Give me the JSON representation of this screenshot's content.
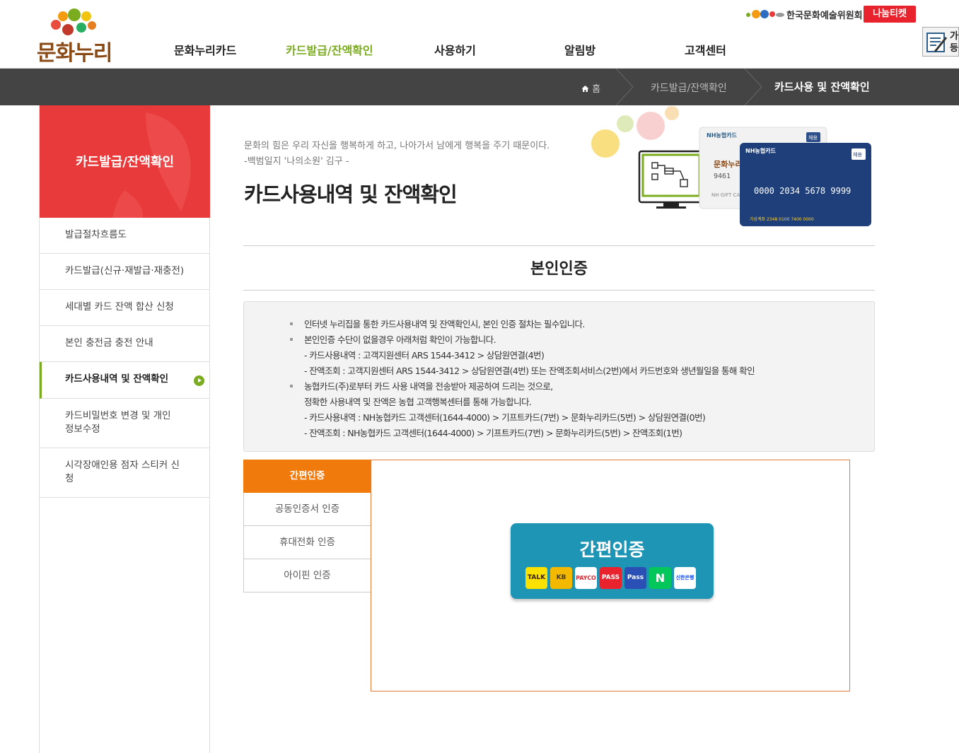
{
  "header": {
    "logo_text": "문화누리",
    "nav": [
      "문화누리카드",
      "카드발급/잔액확인",
      "사용하기",
      "알림방",
      "고객센터"
    ],
    "active_nav": 1,
    "partner_text": "한국문화예술위원회",
    "nanum_label": "나눔티켓",
    "side_tab_text": [
      "가",
      "등"
    ]
  },
  "breadcrumb": {
    "home": "홈",
    "section": "카드발급/잔액확인",
    "current": "카드사용 및 잔액확인"
  },
  "sidebar": {
    "title": "카드발급/잔액확인",
    "items": [
      {
        "label": "발급절차흐름도"
      },
      {
        "label": "카드발급(신규·재발급·재충전)"
      },
      {
        "label": "세대별 카드 잔액 합산 신청"
      },
      {
        "label": "본인 충전금 충전 안내"
      },
      {
        "label": "카드사용내역 및 잔액확인"
      },
      {
        "label": "카드비밀번호 변경 및 개인 정보수정"
      },
      {
        "label": "시각장애인용 점자 스티커 신청"
      }
    ],
    "active_index": 4
  },
  "content": {
    "quote_line1": "문화의 힘은 우리 자신을 행복하게 하고, 나아가서 남에게 행복을 주기 때문이다.",
    "quote_line2": "-백범일지 '나의소원' 김구 -",
    "page_title": "카드사용내역 및 잔액확인",
    "section_title": "본인인증",
    "hero_card": {
      "bank_label": "NH농협카드",
      "card_number": "0000 2034 5678 9999",
      "badge": "체용",
      "gift_label": "NH GIFT CA",
      "small_number": "9461"
    }
  },
  "notice": {
    "lines": [
      "인터넷 누리집을 통한 카드사용내역 및 잔액확인시, 본인 인증 절차는 필수입니다.",
      "본인인증 수단이 없을경우 아래처럼 확인이 가능합니다.",
      "- 카드사용내역 : 고객지원센터 ARS 1544-3412 > 상담원연결(4번)",
      "- 잔액조회 : 고객지원센터 ARS 1544-3412 > 상담원연결(4번) 또는 잔액조회서비스(2번)에서 카드번호와 생년월일을 통해 확인",
      "농협카드(주)로부터 카드 사용 내역을 전송받아 제공하여 드리는 것으로,",
      "정확한 사용내역 및 잔액은 농협 고객행복센터를 통해 가능합니다.",
      "- 카드사용내역 : NH농협카드 고객센터(1644-4000) > 기프트카드(7번) > 문화누리카드(5번) > 상담원연결(0번)",
      "- 잔액조회 : NH농협카드 고객센터(1644-4000) > 기프트카드(7번) > 문화누리카드(5번) > 잔액조회(1번)"
    ]
  },
  "auth": {
    "tabs": [
      "간편인증",
      "공동인증서 인증",
      "휴대전화 인증",
      "아이핀 인증"
    ],
    "active_tab": 0,
    "easy_title": "간편인증",
    "providers": [
      {
        "name": "TALK",
        "bg": "#fae100",
        "fg": "#3c1e1e"
      },
      {
        "name": "KB",
        "bg": "#f2b900",
        "fg": "#4a3a1a"
      },
      {
        "name": "PAYCO",
        "bg": "#ffffff",
        "fg": "#e8232d"
      },
      {
        "name": "PASS",
        "bg": "#e8232d",
        "fg": "#ffffff"
      },
      {
        "name": "Pass",
        "bg": "#2a4fb5",
        "fg": "#ffffff"
      },
      {
        "name": "N",
        "bg": "#03c75a",
        "fg": "#ffffff"
      },
      {
        "name": "신한은행",
        "bg": "#ffffff",
        "fg": "#0046ff"
      }
    ]
  },
  "colors": {
    "accent_green": "#7bac1f",
    "sidebar_red": "#e83a3a",
    "tab_orange": "#f07a0c",
    "easy_blue": "#1e95b5",
    "crumb_bar": "#444444"
  }
}
